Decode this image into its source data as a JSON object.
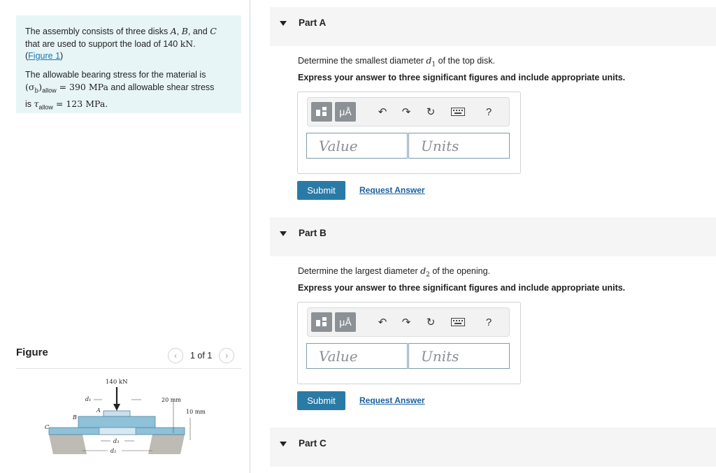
{
  "problem": {
    "line1_start": "The assembly consists of three disks ",
    "disk_a": "A",
    "comma1": ", ",
    "disk_b": "B",
    "and_text": ", and ",
    "disk_c": "C",
    "line2": "that are used to support the load of 140 ",
    "load_unit": "kN",
    "period": ".",
    "figure_link": "Figure 1",
    "paren_open": "(",
    "paren_close": ")",
    "p2_line1": "The allowable bearing stress for the material is",
    "bearing_symbol": "(σ",
    "bearing_sub": "b",
    "bearing_close": ")",
    "allow_sub": "allow",
    "bearing_value": " = 390 MPa",
    "shear_lead": " and allowable shear stress",
    "is_text": "is ",
    "tau_symbol": "τ",
    "shear_value": " = 123 MPa."
  },
  "figure": {
    "title": "Figure",
    "pager": "1 of 1",
    "prev_icon": "chevron-left-icon",
    "next_icon": "chevron-right-icon",
    "load_label": "140 kN",
    "dim_20": "20 mm",
    "dim_10": "10 mm",
    "label_d1": "d₁",
    "label_d2": "d₂",
    "label_d3": "d₃",
    "label_a": "A",
    "label_b": "B",
    "label_c": "C"
  },
  "parts": [
    {
      "label": "Part A",
      "question_pre": "Determine the smallest diameter ",
      "question_var": "d",
      "question_sub": "1",
      "question_post": " of the top disk.",
      "instruction": "Express your answer to three significant figures and include appropriate units.",
      "value_placeholder": "Value",
      "units_placeholder": "Units",
      "submit": "Submit",
      "request": "Request Answer"
    },
    {
      "label": "Part B",
      "question_pre": "Determine the largest diameter ",
      "question_var": "d",
      "question_sub": "2",
      "question_post": " of the opening.",
      "instruction": "Express your answer to three significant figures and include appropriate units.",
      "value_placeholder": "Value",
      "units_placeholder": "Units",
      "submit": "Submit",
      "request": "Request Answer"
    },
    {
      "label": "Part C"
    }
  ],
  "toolbar": {
    "units_symbol": "μÅ",
    "undo_icon": "undo-icon",
    "redo_icon": "redo-icon",
    "reset_icon": "reset-icon",
    "keyboard_icon": "keyboard-icon",
    "help": "?"
  }
}
